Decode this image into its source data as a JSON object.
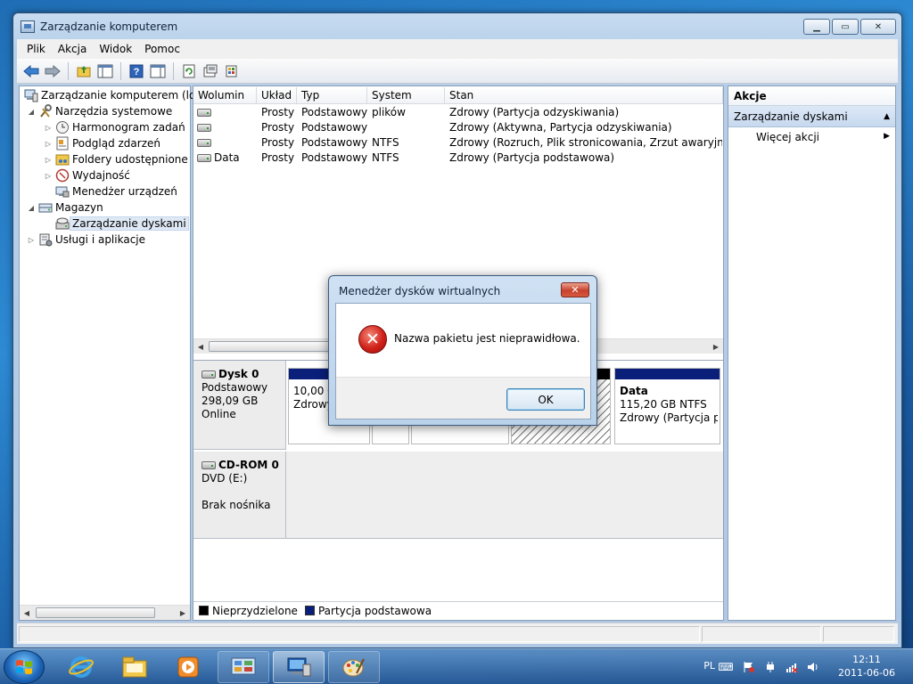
{
  "window": {
    "title": "Zarządzanie komputerem",
    "buttons": {
      "minimize": "▁",
      "maximize": "▭",
      "close": "✕"
    }
  },
  "menu": [
    "Plik",
    "Akcja",
    "Widok",
    "Pomoc"
  ],
  "toolbar_icons": [
    "back-icon",
    "forward-icon",
    "up-folder-icon",
    "show-hide-tree-icon",
    "help-icon",
    "show-hide-action-pane-icon",
    "refresh-icon",
    "properties-icon",
    "export-icon"
  ],
  "tree": [
    {
      "label": "Zarządzanie komputerem (loka",
      "level": 0,
      "expander": "",
      "icon": "computer-management-icon"
    },
    {
      "label": "Narzędzia systemowe",
      "level": 1,
      "expander": "◢",
      "icon": "tools-icon"
    },
    {
      "label": "Harmonogram zadań",
      "level": 2,
      "expander": "▷",
      "icon": "clock-icon"
    },
    {
      "label": "Podgląd zdarzeń",
      "level": 2,
      "expander": "▷",
      "icon": "event-viewer-icon"
    },
    {
      "label": "Foldery udostępnione",
      "level": 2,
      "expander": "▷",
      "icon": "shared-folder-icon"
    },
    {
      "label": "Wydajność",
      "level": 2,
      "expander": "▷",
      "icon": "performance-icon"
    },
    {
      "label": "Menedżer urządzeń",
      "level": 2,
      "expander": "",
      "icon": "device-manager-icon"
    },
    {
      "label": "Magazyn",
      "level": 1,
      "expander": "◢",
      "icon": "storage-icon"
    },
    {
      "label": "Zarządzanie dyskami",
      "level": 2,
      "expander": "",
      "icon": "disk-management-icon",
      "selected": true
    },
    {
      "label": "Usługi i aplikacje",
      "level": 1,
      "expander": "▷",
      "icon": "services-icon"
    }
  ],
  "volumes": {
    "columns": [
      "Wolumin",
      "Układ",
      "Typ",
      "System plików",
      "Stan"
    ],
    "rows": [
      [
        "",
        "Prosty",
        "Podstawowy",
        "",
        "Zdrowy (Partycja odzyskiwania)"
      ],
      [
        "",
        "Prosty",
        "Podstawowy",
        "",
        "Zdrowy (Aktywna, Partycja odzyskiwania)"
      ],
      [
        "",
        "Prosty",
        "Podstawowy",
        "NTFS",
        "Zdrowy (Rozruch, Plik stronicowania, Zrzut awaryjny, Party"
      ],
      [
        "Data",
        "Prosty",
        "Podstawowy",
        "NTFS",
        "Zdrowy (Partycja podstawowa)"
      ]
    ]
  },
  "disks": [
    {
      "name": "Dysk 0",
      "type": "Podstawowy",
      "size": "298,09 GB",
      "status": "Online"
    },
    {
      "name": "CD-ROM 0",
      "type": "DVD (E:)",
      "size": "",
      "status": "Brak nośnika"
    }
  ],
  "partitions": {
    "p1_size": "10,00 GB",
    "p1_status": "Zdrowy",
    "data_name": "Data",
    "data_size": "115,20 GB NTFS",
    "data_status": "Zdrowy (Partycja po"
  },
  "legend": {
    "unallocated": "Nieprzydzielone",
    "primary": "Partycja podstawowa"
  },
  "actions": {
    "title": "Akcje",
    "section": "Zarządzanie dyskami",
    "more": "Więcej akcji"
  },
  "dialog": {
    "title": "Menedżer dysków wirtualnych",
    "message": "Nazwa pakietu jest nieprawidłowa.",
    "ok": "OK",
    "close": "✕"
  },
  "taskbar": {
    "apps": [
      "internet-explorer-icon",
      "windows-explorer-icon",
      "media-player-icon",
      "control-panel-icon",
      "computer-management-icon",
      "paint-icon"
    ],
    "language": "PL",
    "time": "12:11",
    "date": "2011-06-06"
  },
  "colors": {
    "primary_partition": "#0a1f7a",
    "unallocated": "#000000",
    "selection": "#dfe9f5"
  }
}
